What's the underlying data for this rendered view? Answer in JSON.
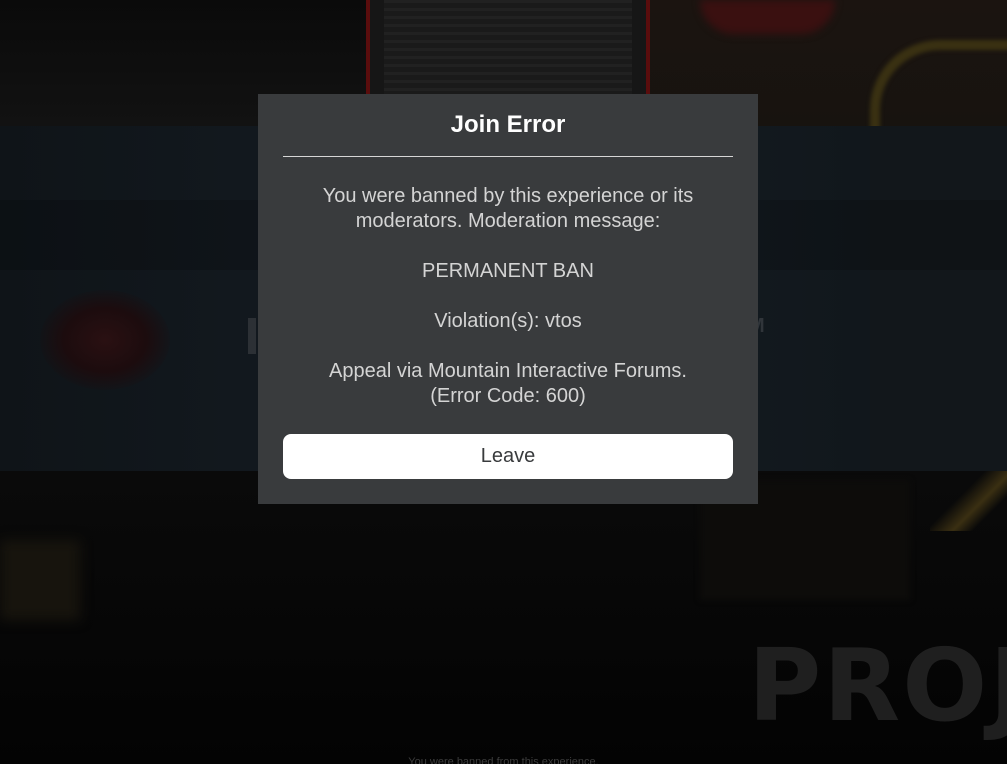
{
  "dialog": {
    "title": "Join Error",
    "line1": "You were banned by this experience or its",
    "line2": "moderators. Moderation message:",
    "ban_type": "PERMANENT BAN",
    "violation": "Violation(s): vtos",
    "appeal": "Appeal via Mountain Interactive Forums.",
    "error_code": "(Error Code: 600)",
    "leave_label": "Leave"
  },
  "background": {
    "large_text": "PROJ",
    "right_letter": "M",
    "bottom_caption": "You were banned from this experience."
  },
  "colors": {
    "dialog_bg": "#393b3d",
    "title": "#ffffff",
    "body_text": "#d4d4d4",
    "button_bg": "#ffffff",
    "button_text": "#393b3d"
  }
}
